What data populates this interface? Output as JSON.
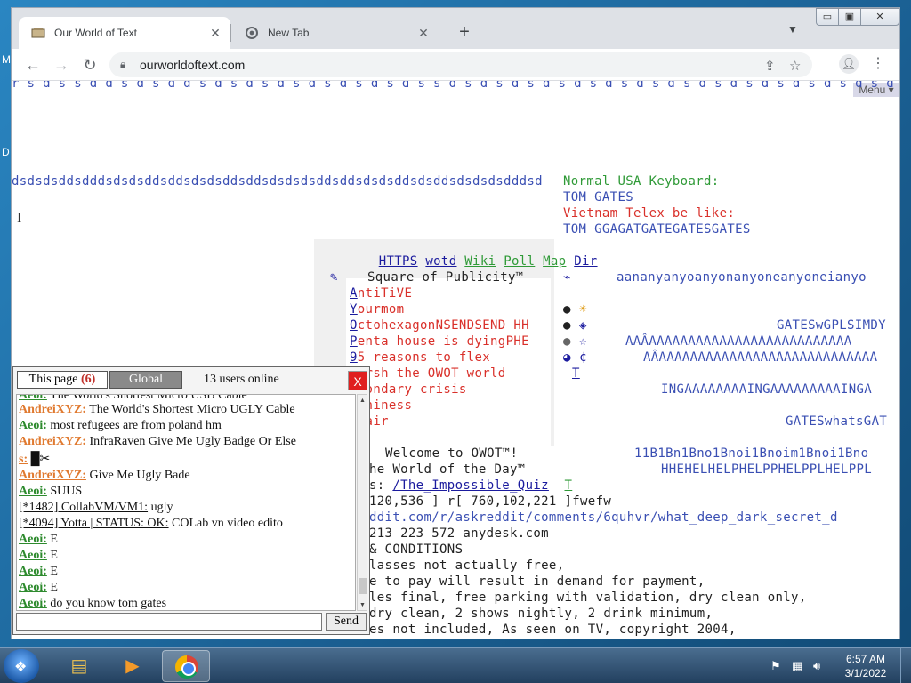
{
  "browser": {
    "tabs": [
      {
        "title": "Our World of Text",
        "icon": "owot-favicon"
      },
      {
        "title": "New Tab",
        "icon": "chrome-favicon"
      }
    ],
    "url": "ourworldoftext.com",
    "window_controls": {
      "minimize": "▭",
      "maximize": "▣",
      "close": "✕"
    }
  },
  "page": {
    "menu_label": "Menu ▾",
    "top_row": "r s d s s d d s d s d d s d s d s d s d s d s d s d s s d s d s d s d s d s d s d s d s d s d s d s d s d s d s d s d s d s d s d s d s d s d s d s d s d s d",
    "ds_row": "dsdsdsddsdddsdsdsddsddsdsdsddsddsdsdsdsddsddsdsdsddsdsddsdsdsdsdddsd",
    "keyboard": {
      "line1": "Normal USA Keyboard:",
      "line2": "TOM GATES",
      "line3": "Vietnam Telex be like:",
      "line4": "TOM GGAGATGATEGATESGATES"
    },
    "links": [
      "HTTPS",
      "wotd",
      "Wiki",
      "Poll",
      "Map",
      "Dir"
    ],
    "publicity": {
      "title": "Square of Publicity™",
      "items": [
        {
          "first": "A",
          "rest": "ntiTiVE",
          "color": "red"
        },
        {
          "first": "Y",
          "rest": "ourmom",
          "color": "red"
        },
        {
          "first": "O",
          "rest": "ctohexagonNSENDSEND HH",
          "color": "red"
        },
        {
          "first": "P",
          "rest": "enta house is dyingPHE",
          "color": "red"
        },
        {
          "first": "9",
          "rest": "5 reasons to flex",
          "color": "red"
        },
        {
          "first": "",
          "rest": "Harsh the OWOT world",
          "color": "red"
        },
        {
          "first": "",
          "rest": "econdary crisis",
          "color": "red"
        },
        {
          "first": "",
          "rest": "inniness",
          "color": "red"
        },
        {
          "first": "",
          "rest": "spair",
          "color": "red"
        }
      ]
    },
    "anyone_row": "aananyanyoanyonanyoneanyoneianyo",
    "gates_row1": "GATESwGPLSIMDY",
    "a_row1": "AAÂAAAAAAAAAAAAAAAAAAAAAAAAAA",
    "a_row2": "AÂAAAAAAAAAAAAAAAAAAAAAAAAAAAA",
    "t_glyph": "T",
    "inga_row": "INGAAAAAAAAINGAAAAAAAAAINGA",
    "gates_row2": "GATESwhatsGAT",
    "welcome": "Welcome to OWOT™!",
    "bno_row": "11B1Bn1Bno1Bnoi1Bnoim1Bnoi1Bno",
    "word_of_day": "he World of the Day™",
    "help_row": "HHEHELHELPHELPPHELPPLHELPPL",
    "quiz_prefix": "s: ",
    "quiz_link": "/The_Impossible_Quiz",
    "quiz_suffix": "T",
    "coords_row": "120,536 ] r[ 760,102,221 ]fwefw",
    "reddit_row": "ddit.com/r/askreddit/comments/6quhvr/what_deep_dark_secret_d",
    "anydesk_row": "213 223 572 anydesk.com",
    "conditions_row": "& CONDITIONS",
    "terms": [
      "lasses not actually free,",
      "e to pay will result in demand for payment,",
      "les final, free parking with validation, dry clean only,",
      "dry clean, 2 shows nightly, 2 drink minimum,",
      "es not included, As seen on TV, copyright 2004,"
    ]
  },
  "chat": {
    "tab_page_label": "This page",
    "tab_page_count": "(6)",
    "tab_global_label": "Global",
    "users_online": "13 users online",
    "close_label": "X",
    "messages": [
      {
        "nick": "Aeoi:",
        "nick_style": "green",
        "text": " The World's Shortest Micro USB Cable"
      },
      {
        "nick": "AndreiXYZ:",
        "nick_style": "orange",
        "text": " The World's Shortest Micro UGLY Cable"
      },
      {
        "nick": "Aeoi:",
        "nick_style": "green",
        "text": " most refugees are from poland hm"
      },
      {
        "nick": "AndreiXYZ:",
        "nick_style": "orange",
        "text": " InfraRaven Give Me Ugly Badge Or Else"
      },
      {
        "nick": "s:",
        "nick_style": "orange",
        "text": " █✂"
      },
      {
        "nick": "AndreiXYZ:",
        "nick_style": "orange",
        "text": " Give Me Ugly Bade"
      },
      {
        "nick": "Aeoi:",
        "nick_style": "green",
        "text": " SUUS"
      },
      {
        "nick": "[*1482] CollabVM/VM1:",
        "nick_style": "plain",
        "text": " ugly"
      },
      {
        "nick": "[*4094] Yotta | STATUS: OK:",
        "nick_style": "plain",
        "text": " COLab vn video edito"
      },
      {
        "nick": "Aeoi:",
        "nick_style": "green",
        "text": " E"
      },
      {
        "nick": "Aeoi:",
        "nick_style": "green",
        "text": " E"
      },
      {
        "nick": "Aeoi:",
        "nick_style": "green",
        "text": " E"
      },
      {
        "nick": "Aeoi:",
        "nick_style": "green",
        "text": " E"
      },
      {
        "nick": "Aeoi:",
        "nick_style": "green",
        "text": " do you know tom gates"
      }
    ],
    "input_value": "",
    "send_label": "Send"
  },
  "taskbar": {
    "time": "6:57 AM",
    "date": "3/1/2022"
  },
  "desktop": {
    "edge_letters": [
      "M",
      "D"
    ]
  }
}
